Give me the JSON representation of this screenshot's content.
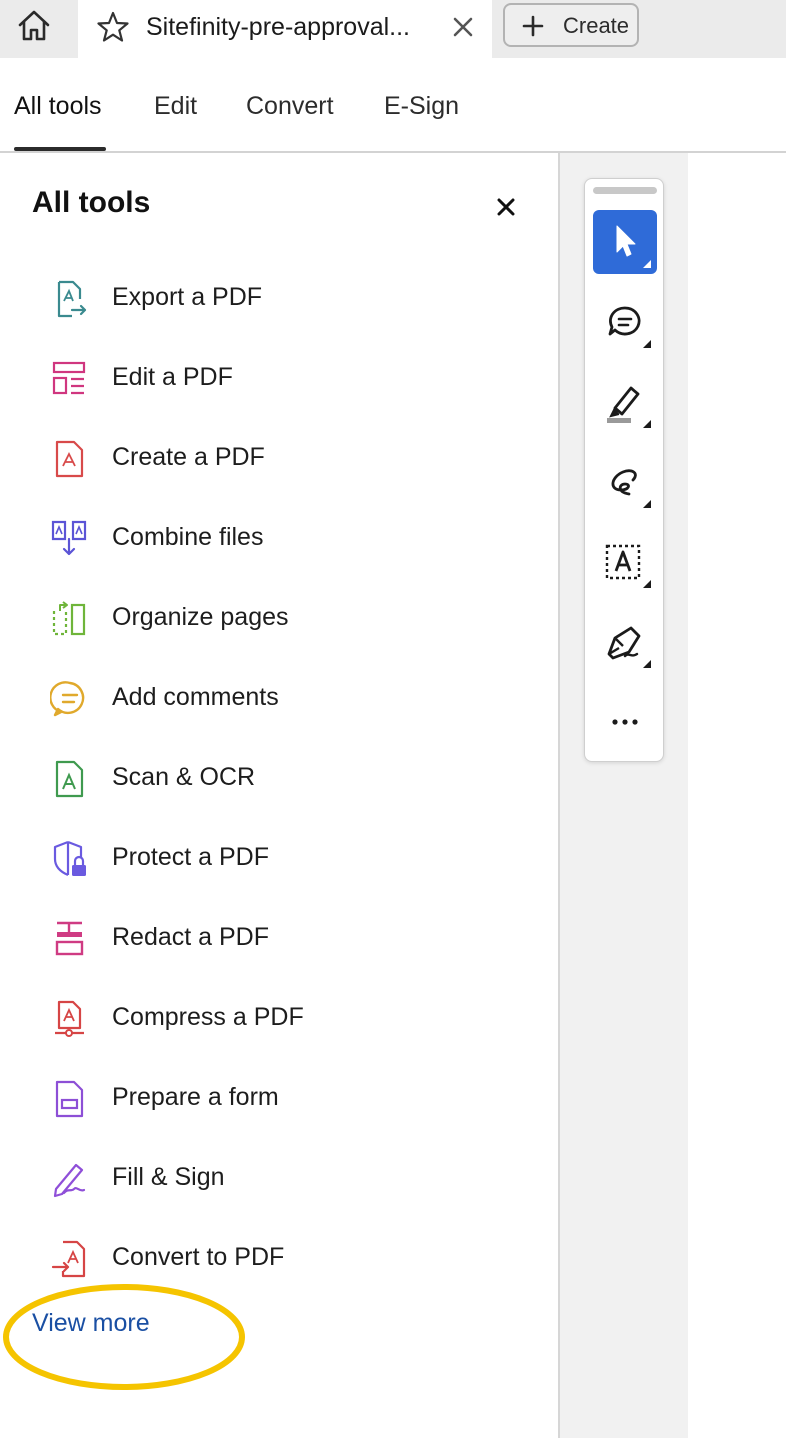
{
  "tabbar": {
    "home_icon": "home-icon",
    "tab_title": "Sitefinity-pre-approval...",
    "star_icon": "star-icon",
    "close_icon": "close-icon",
    "create_label": "Create",
    "create_icon": "plus-icon"
  },
  "nav": {
    "items": [
      {
        "label": "All tools",
        "active": true
      },
      {
        "label": "Edit"
      },
      {
        "label": "Convert"
      },
      {
        "label": "E-Sign"
      }
    ]
  },
  "panel": {
    "title": "All tools",
    "close_icon": "close-icon",
    "tools": [
      {
        "label": "Export a PDF",
        "icon": "export-pdf-icon",
        "color": "#3a8a8f"
      },
      {
        "label": "Edit a PDF",
        "icon": "edit-pdf-icon",
        "color": "#d0367f"
      },
      {
        "label": "Create a PDF",
        "icon": "create-pdf-icon",
        "color": "#d84a4a"
      },
      {
        "label": "Combine files",
        "icon": "combine-files-icon",
        "color": "#5b54d6"
      },
      {
        "label": "Organize pages",
        "icon": "organize-pages-icon",
        "color": "#6fb53a"
      },
      {
        "label": "Add comments",
        "icon": "comment-icon",
        "color": "#e0a92c"
      },
      {
        "label": "Scan & OCR",
        "icon": "scan-ocr-icon",
        "color": "#3f9a4f"
      },
      {
        "label": "Protect a PDF",
        "icon": "protect-pdf-icon",
        "color": "#6a5ae0"
      },
      {
        "label": "Redact a PDF",
        "icon": "redact-pdf-icon",
        "color": "#cf3b83"
      },
      {
        "label": "Compress a PDF",
        "icon": "compress-pdf-icon",
        "color": "#d64545"
      },
      {
        "label": "Prepare a form",
        "icon": "prepare-form-icon",
        "color": "#8d4fd6"
      },
      {
        "label": "Fill & Sign",
        "icon": "fill-sign-icon",
        "color": "#8f4fd8"
      },
      {
        "label": "Convert to PDF",
        "icon": "convert-to-pdf-icon",
        "color": "#d64545"
      }
    ],
    "view_more": "View more",
    "highlight_color": "#f5c400"
  },
  "quick_toolbar": {
    "active_color": "#2f6bd8",
    "tools": [
      {
        "icon": "select-cursor-icon",
        "active": true
      },
      {
        "icon": "comment-icon"
      },
      {
        "icon": "highlighter-icon"
      },
      {
        "icon": "draw-freehand-icon"
      },
      {
        "icon": "text-box-icon"
      },
      {
        "icon": "sign-pen-icon"
      },
      {
        "icon": "more-icon"
      }
    ]
  }
}
